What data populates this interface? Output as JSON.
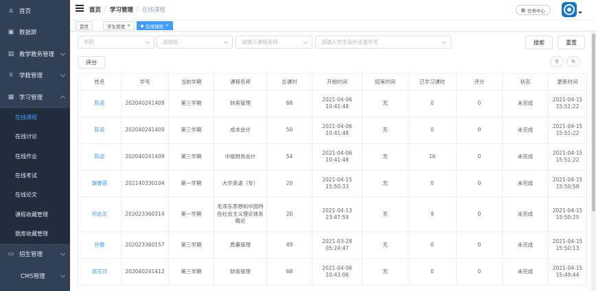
{
  "sidebar": {
    "items": [
      {
        "label": "首页",
        "icon": "home-icon",
        "glyph": "⌂"
      },
      {
        "label": "数据屏",
        "icon": "monitor-icon",
        "glyph": "▣"
      },
      {
        "label": "教学教务管理",
        "icon": "printer-icon",
        "glyph": "▤"
      },
      {
        "label": "学籍管理",
        "icon": "graduation-cap-icon",
        "glyph": "♕"
      },
      {
        "label": "学习管理",
        "icon": "book-icon",
        "glyph": "▦"
      }
    ],
    "sub_items": [
      {
        "label": "在线课程"
      },
      {
        "label": "在线讨论"
      },
      {
        "label": "在线作业"
      },
      {
        "label": "在线考试"
      },
      {
        "label": "在线论文"
      },
      {
        "label": "课程收藏管理"
      },
      {
        "label": "题库收藏管理"
      }
    ],
    "bottom_items": [
      {
        "label": "招生管理",
        "icon": "enroll-icon",
        "glyph": "▭"
      },
      {
        "label": "CMS管理"
      }
    ]
  },
  "navbar": {
    "breadcrumb": [
      "首页",
      "学习管理",
      "在线课程"
    ],
    "task_center": "任务中心",
    "task_glyph": "▦"
  },
  "tags": [
    {
      "label": "首页"
    },
    {
      "label": "学生管理",
      "close": "×"
    },
    {
      "label": "在线课程",
      "close": "×"
    }
  ],
  "filters": {
    "college_placeholder": "学院",
    "station_placeholder": "函授站",
    "course_placeholder": "请输入课程名称",
    "student_placeholder": "请输入学生身份证或学号",
    "search_label": "搜索",
    "reset_label": "重置",
    "score_label": "评分",
    "search_icon_glyph": "⚲",
    "refresh_icon_glyph": "↻"
  },
  "table": {
    "headers": [
      "姓名",
      "学号",
      "当前学期",
      "课程名称",
      "总课时",
      "开始时间",
      "结束时间",
      "已学习课时",
      "评分",
      "状态",
      "更新时间"
    ],
    "rows": [
      [
        "陈诺",
        "202040241409",
        "第三学期",
        "财务管理",
        "68",
        "2021-04-06 10:41:48",
        "无",
        "0",
        "0",
        "未完成",
        "2021-04-15 15:51:22"
      ],
      [
        "陈诺",
        "202040241409",
        "第三学期",
        "成本会计",
        "50",
        "2021-04-06 10:41:48",
        "无",
        "0",
        "0",
        "未完成",
        "2021-04-15 15:51:22"
      ],
      [
        "陈诺",
        "202040241409",
        "第三学期",
        "中级财务会计",
        "54",
        "2021-04-06 10:41:48",
        "无",
        "16",
        "0",
        "未完成",
        "2021-04-15 15:51:22"
      ],
      [
        "魏春霞",
        "202140330104",
        "第一学期",
        "大学英语（专）",
        "20",
        "2021-04-15 15:50:33",
        "无",
        "0",
        "0",
        "未完成",
        "2021-04-15 15:50:58"
      ],
      [
        "何志龙",
        "202023360314",
        "第一学期",
        "毛泽东思想和中国特色社会主义理论体系概论",
        "20",
        "2021-04-13 23:47:59",
        "无",
        "9",
        "0",
        "未完成",
        "2021-04-15 15:50:25"
      ],
      [
        "孙蕾",
        "202023360157",
        "第三学期",
        "质量管理",
        "49",
        "2021-03-28 05:24:47",
        "无",
        "0",
        "0",
        "未完成",
        "2021-04-15 15:50:13"
      ],
      [
        "郭玉玲",
        "202040241412",
        "第三学期",
        "财务管理",
        "68",
        "2021-04-06 10:43:06",
        "无",
        "0",
        "0",
        "未完成",
        "2021-04-15 15:49:44"
      ]
    ]
  }
}
